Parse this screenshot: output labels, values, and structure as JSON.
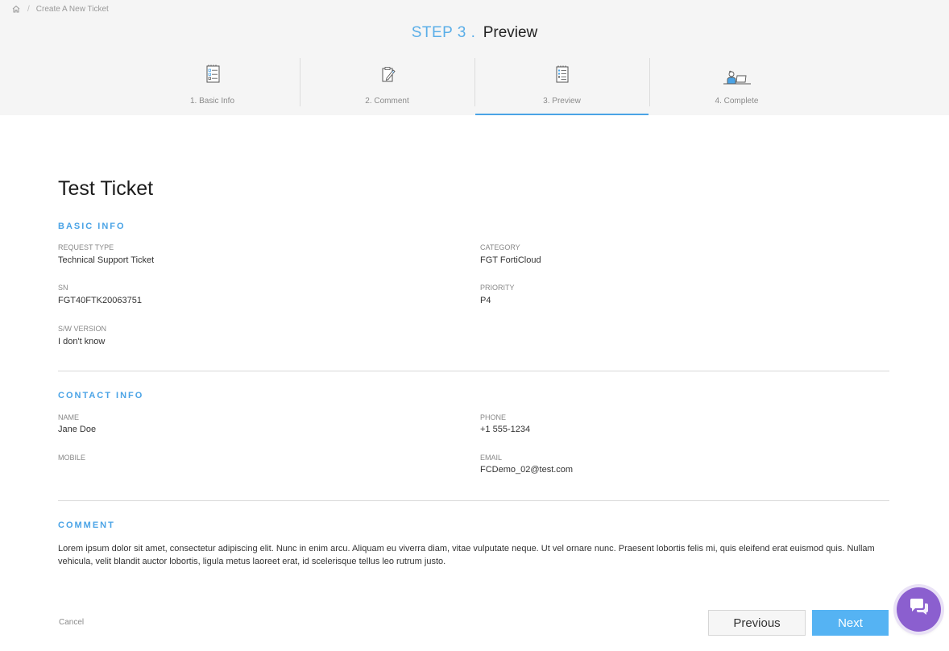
{
  "breadcrumb": {
    "home_icon": "home-icon",
    "separator": "/",
    "current": "Create A New Ticket"
  },
  "step": {
    "label": "STEP 3 .",
    "name": "Preview"
  },
  "tabs": [
    {
      "label": "1. Basic Info",
      "icon": "clipboard-checklist-icon"
    },
    {
      "label": "2. Comment",
      "icon": "clipboard-pen-icon"
    },
    {
      "label": "3. Preview",
      "icon": "document-list-icon",
      "active": true
    },
    {
      "label": "4. Complete",
      "icon": "person-laptop-icon"
    }
  ],
  "ticket": {
    "title": "Test Ticket"
  },
  "basic_info": {
    "heading": "BASIC INFO",
    "request_type_label": "REQUEST TYPE",
    "request_type_value": "Technical Support Ticket",
    "category_label": "CATEGORY",
    "category_value": "FGT FortiCloud",
    "sn_label": "SN",
    "sn_value": "FGT40FTK20063751",
    "priority_label": "PRIORITY",
    "priority_value": "P4",
    "sw_version_label": "S/W VERSION",
    "sw_version_value": "I don't know"
  },
  "contact_info": {
    "heading": "CONTACT INFO",
    "name_label": "NAME",
    "name_value": "Jane Doe",
    "phone_label": "PHONE",
    "phone_value": "+1 555-1234",
    "mobile_label": "MOBILE",
    "mobile_value": "",
    "email_label": "EMAIL",
    "email_value": "FCDemo_02@test.com"
  },
  "comment": {
    "heading": "COMMENT",
    "text": "Lorem ipsum dolor sit amet, consectetur adipiscing elit. Nunc in enim arcu. Aliquam eu viverra diam, vitae vulputate neque. Ut vel ornare nunc. Praesent lobortis felis mi, quis eleifend erat euismod quis. Nullam vehicula, velit blandit auctor lobortis, ligula metus laoreet erat, id scelerisque tellus leo rutrum justo."
  },
  "footer": {
    "cancel_label": "Cancel",
    "previous_label": "Previous",
    "next_label": "Next"
  },
  "chat": {
    "icon": "chat-bubbles-icon"
  },
  "colors": {
    "accent": "#4aa3e6",
    "next_button": "#55b3f3",
    "chat_button": "#8b5fcf"
  }
}
